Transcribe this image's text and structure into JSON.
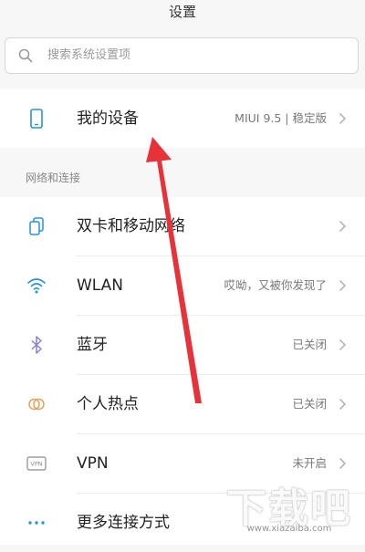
{
  "header": {
    "title": "设置"
  },
  "search": {
    "placeholder": "搜索系统设置项"
  },
  "device": {
    "label": "我的设备",
    "value": "MIUI 9.5 | 稳定版"
  },
  "section": {
    "title": "网络和连接"
  },
  "items": [
    {
      "label": "双卡和移动网络",
      "value": ""
    },
    {
      "label": "WLAN",
      "value": "哎呦，又被你发现了"
    },
    {
      "label": "蓝牙",
      "value": "已关闭"
    },
    {
      "label": "个人热点",
      "value": "已关闭"
    },
    {
      "label": "VPN",
      "value": "未开启"
    },
    {
      "label": "更多连接方式",
      "value": ""
    }
  ],
  "vpn_icon_text": "VPN",
  "watermark": {
    "text": "下载吧",
    "url": "www.xiazaiba.com"
  },
  "colors": {
    "accent_blue": "#2196d9",
    "arrow_red": "#e8323a",
    "bluetooth_purple": "#8a7dd6",
    "hotspot_orange": "#e6a25a"
  }
}
